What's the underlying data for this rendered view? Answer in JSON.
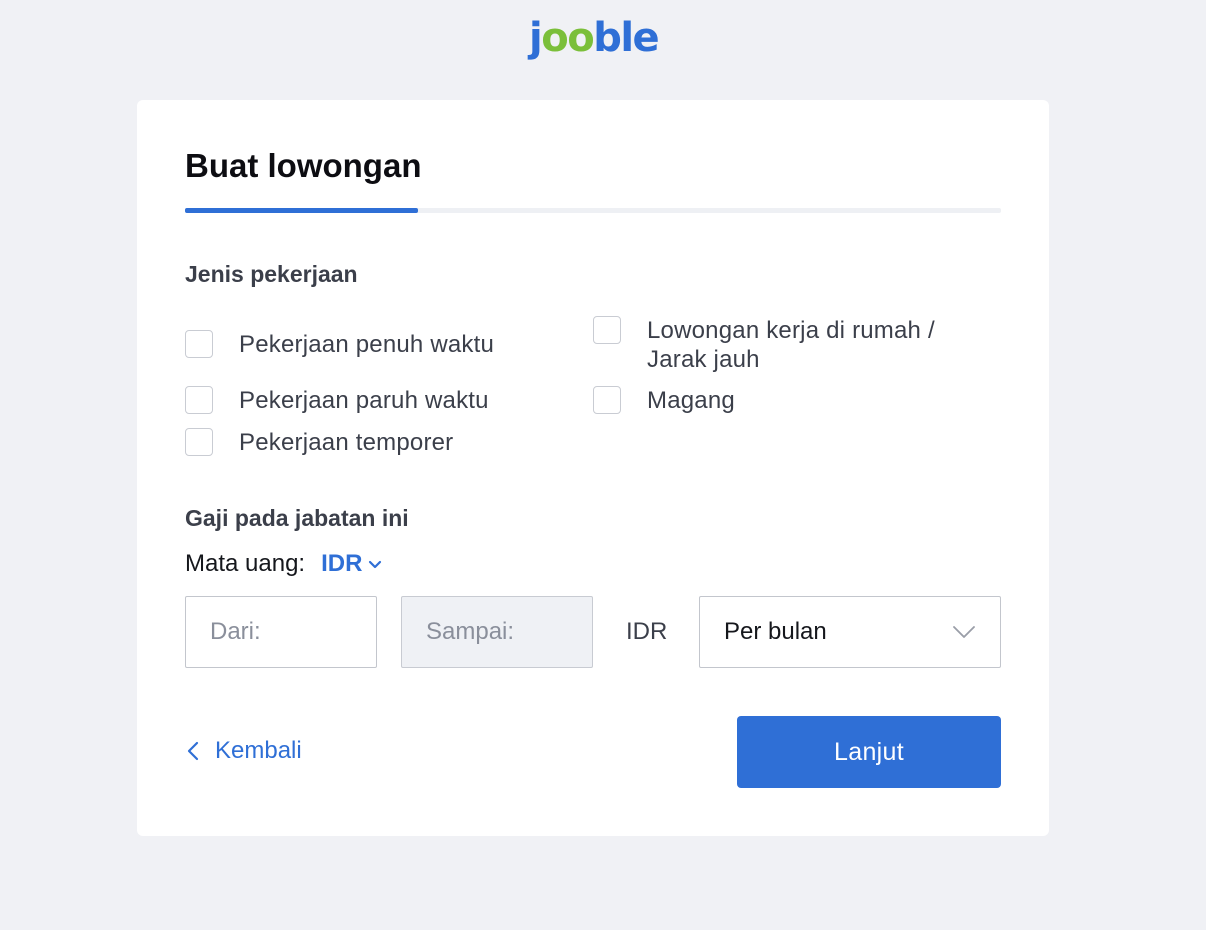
{
  "logo": {
    "text": "jooble"
  },
  "form": {
    "title": "Buat lowongan",
    "progress": 0.2857,
    "job_type": {
      "heading": "Jenis pekerjaan",
      "options": [
        {
          "label": "Pekerjaan penuh waktu",
          "checked": false
        },
        {
          "label": "Lowongan kerja di rumah / Jarak jauh",
          "checked": false
        },
        {
          "label": "Pekerjaan paruh waktu",
          "checked": false
        },
        {
          "label": "Magang",
          "checked": false
        },
        {
          "label": "Pekerjaan temporer",
          "checked": false
        }
      ]
    },
    "salary": {
      "heading": "Gaji pada jabatan ini",
      "currency_label": "Mata uang:",
      "currency_value": "IDR",
      "from_placeholder": "Dari:",
      "to_placeholder": "Sampai:",
      "unit": "IDR",
      "period_value": "Per bulan"
    },
    "back_label": "Kembali",
    "next_label": "Lanjut"
  },
  "colors": {
    "accent": "#2f6fd6",
    "logo_green": "#7bbf3a",
    "background": "#f0f1f5"
  },
  "icons": {
    "currency_dropdown": "chevron-down-icon",
    "period_dropdown": "chevron-down-icon",
    "back": "chevron-left-icon"
  }
}
